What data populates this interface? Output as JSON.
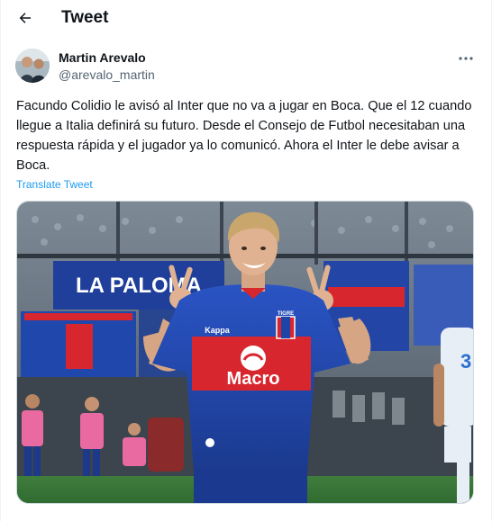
{
  "header": {
    "back_icon": "arrow-left-icon",
    "title": "Tweet"
  },
  "tweet": {
    "author_name": "Martin Arevalo",
    "author_handle": "@arevalo_martin",
    "more_icon": "more-horizontal-icon",
    "text": "Facundo Colidio le avisó al Inter que no va a jugar en Boca. Que el 12 cuando llegue a Italia definirá su futuro. Desde el Consejo de Futbol necesitaban una respuesta rápida y el jugador ya lo comunicó. Ahora el Inter le debe avisar a Boca.",
    "translate_label": "Translate Tweet",
    "media": {
      "sponsor": "Macro",
      "kit_brand": "Kappa",
      "stadium_banner": "LA PALOMA",
      "badge": "TIGRE"
    }
  },
  "colors": {
    "accent": "#1d9bf0",
    "text_primary": "#0f1419",
    "text_secondary": "#536471",
    "jersey_blue": "#1f44a8",
    "jersey_red": "#d8262e"
  }
}
